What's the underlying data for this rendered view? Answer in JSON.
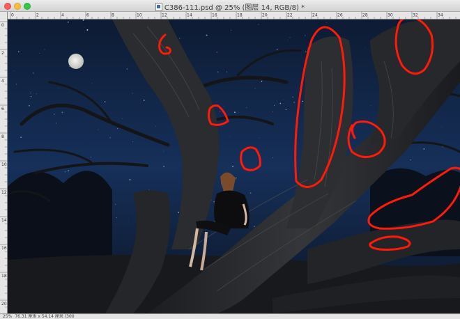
{
  "window": {
    "title": "C386-111.psd @ 25% (图层 14, RGB/8) *"
  },
  "ruler": {
    "h_labels": [
      "0",
      "2",
      "4",
      "6",
      "8",
      "10",
      "12",
      "14",
      "16",
      "18",
      "20",
      "22",
      "24",
      "26",
      "28",
      "30",
      "32",
      "34"
    ],
    "v_labels": [
      "0",
      "2",
      "4",
      "6",
      "8",
      "10",
      "12",
      "14",
      "16",
      "18",
      "20"
    ]
  },
  "status": {
    "zoom": "25%",
    "doc_info": "76.31 厘米 x 54.14 厘米 (300"
  },
  "colors": {
    "annotation": "#ff1a0a",
    "sky": "#13294a"
  },
  "icons": [
    "close-icon",
    "minimize-icon",
    "maximize-icon",
    "psd-file-icon"
  ]
}
